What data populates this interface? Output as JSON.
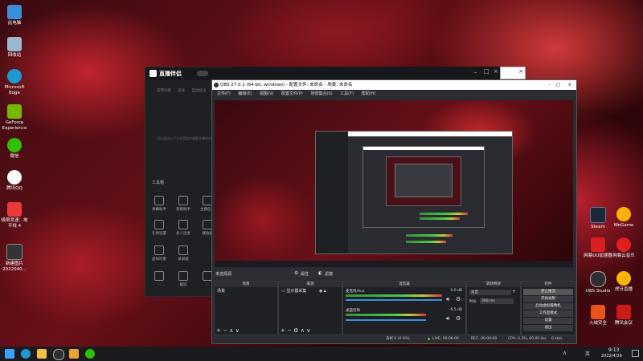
{
  "desktop": {
    "icons": [
      {
        "label": "此电脑",
        "color": "#3b8fd9"
      },
      {
        "label": "回收站",
        "color": "#9bb8d0"
      },
      {
        "label": "Microsoft Edge",
        "color": "#1d9bd1"
      },
      {
        "label": "GeForce Experience",
        "color": "#76b900"
      },
      {
        "label": "微信",
        "color": "#2dc100"
      },
      {
        "label": "腾讯QQ",
        "color": "#ffffff"
      },
      {
        "label": "极限竞速：地平线 4",
        "color": "#e83a3a"
      },
      {
        "label": "新建图片 2022040...",
        "color": "#333"
      }
    ],
    "right_icons": [
      {
        "label": "Steam",
        "color": "#1b2838"
      },
      {
        "label": "WeGame",
        "color": "#ffb000"
      },
      {
        "label": "网易UU加速器",
        "color": "#d92020"
      },
      {
        "label": "网易云音乐",
        "color": "#e02020"
      },
      {
        "label": "OBS Studio",
        "color": "#302e31"
      },
      {
        "label": "虎牙直播",
        "color": "#ffb400"
      },
      {
        "label": "火绒安全",
        "color": "#e8541a"
      },
      {
        "label": "腾讯会议",
        "color": "#cc1a1a"
      }
    ]
  },
  "companion": {
    "title": "直播伴侣",
    "menu": [
      "常用功能",
      "美化",
      "互动玩法"
    ],
    "hint": "可以通过以下方式添加你想要开播的内容",
    "tools_heading": "工具箱",
    "tools": [
      "弹幕助手",
      "观看助手",
      "主播任务",
      "礼物设置",
      "多人连麦",
      "播放器",
      "虚拟形象",
      "录屏器",
      "...",
      "截屏",
      "...",
      "..."
    ]
  },
  "obs": {
    "title": "OBS 27.0.1 (64-bit, windows) - 配置文件: 未命名 - 场景: 未命名",
    "menu": [
      "文件(F)",
      "编辑(E)",
      "视图(V)",
      "配置文件(P)",
      "场景集合(S)",
      "工具(T)",
      "帮助(H)"
    ],
    "no_source_label": "未选择源",
    "props_btn": "属性",
    "filters_btn": "滤镜",
    "panels": {
      "scenes": "场景",
      "sources": "来源",
      "mixer": "混音器",
      "transitions": "转场特效",
      "controls": "控件"
    },
    "scene_item": "场景",
    "source_item": "显示器采集",
    "mixer_tracks": [
      {
        "name": "麦克风/Aux",
        "db": "0.0 dB"
      },
      {
        "name": "桌面音频",
        "db": "-6.5 dB"
      }
    ],
    "transition": {
      "type": "淡出",
      "duration_label": "时长",
      "duration": "300 ms"
    },
    "controls": [
      "停止推流",
      "开始录制",
      "启动虚拟摄像机",
      "工作室模式",
      "设置",
      "退出"
    ],
    "status": {
      "drop": "丢帧 0 (0.0%)",
      "live": "LIVE: 00:00:00",
      "rec": "REC: 00:00:00",
      "cpu": "CPU: 0.3%, 60.00 fps",
      "bitrate": "0 kb/s"
    }
  },
  "taskbar": {
    "time": "9:13",
    "date": "2022/4/29",
    "tray_ime": "英"
  }
}
